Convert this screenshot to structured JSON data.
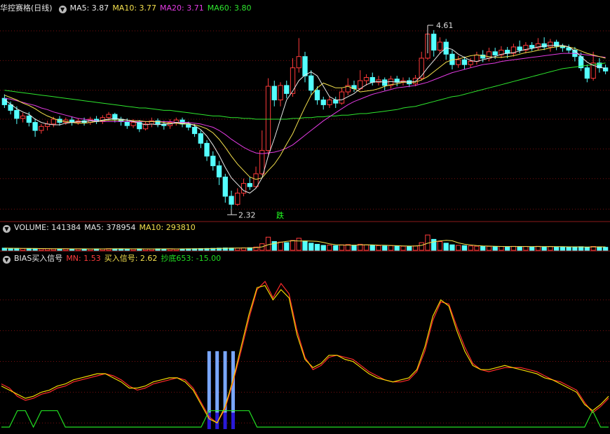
{
  "colors": {
    "up": "#ff3a3a",
    "down": "#54ffff",
    "ma5": "#e8e8e8",
    "ma10": "#f4e04d",
    "ma20": "#e33be3",
    "ma60": "#2ee62e",
    "grid": "#7a1010",
    "frame": "#8b1a1a",
    "bias_red": "#ff2a2a",
    "bias_yellow": "#f4d800",
    "signal_green": "#22dd22",
    "bar_light": "#7aa7ff",
    "bar_dark": "#2a1ad8"
  },
  "price_panel": {
    "name": "华控赛格(日线)",
    "ma5_label": "MA5: 3.87",
    "ma10_label": "MA10: 3.77",
    "ma20_label": "MA20: 3.71",
    "ma60_label": "MA60: 3.80",
    "high_label": "4.61",
    "low_label": "2.32",
    "marker_text": "跌",
    "collapse_icon": "chevron-down-icon"
  },
  "volume_panel": {
    "name": "VOLUME: 141384",
    "ma5_label": "MA5: 378954",
    "ma10_label": "MA10: 293810"
  },
  "bias_panel": {
    "name": "BIAS买入信号",
    "mn_label": "MN: 1.53",
    "buy_label": "买入信号: 2.62",
    "bottom_label": "抄底653: -15.00"
  },
  "chart_data": {
    "type": "candlestick",
    "price_ylim": [
      2.2,
      4.75
    ],
    "price_gridlines": [
      2.32,
      2.7,
      3.07,
      3.44,
      3.8,
      4.17,
      4.54
    ],
    "candles": [
      [
        3.7,
        3.62,
        3.75,
        3.58
      ],
      [
        3.62,
        3.55,
        3.66,
        3.5
      ],
      [
        3.55,
        3.45,
        3.6,
        3.38
      ],
      [
        3.45,
        3.48,
        3.52,
        3.4
      ],
      [
        3.48,
        3.4,
        3.53,
        3.35
      ],
      [
        3.4,
        3.3,
        3.45,
        3.22
      ],
      [
        3.3,
        3.35,
        3.38,
        3.26
      ],
      [
        3.35,
        3.38,
        3.42,
        3.3
      ],
      [
        3.38,
        3.44,
        3.47,
        3.34
      ],
      [
        3.44,
        3.4,
        3.48,
        3.36
      ],
      [
        3.4,
        3.43,
        3.46,
        3.37
      ],
      [
        3.43,
        3.4,
        3.47,
        3.36
      ],
      [
        3.4,
        3.42,
        3.45,
        3.37
      ],
      [
        3.42,
        3.4,
        3.46,
        3.36
      ],
      [
        3.4,
        3.44,
        3.47,
        3.37
      ],
      [
        3.44,
        3.41,
        3.48,
        3.38
      ],
      [
        3.41,
        3.46,
        3.49,
        3.38
      ],
      [
        3.46,
        3.5,
        3.53,
        3.42
      ],
      [
        3.5,
        3.44,
        3.52,
        3.4
      ],
      [
        3.44,
        3.41,
        3.47,
        3.36
      ],
      [
        3.41,
        3.36,
        3.45,
        3.32
      ],
      [
        3.36,
        3.4,
        3.44,
        3.33
      ],
      [
        3.4,
        3.32,
        3.43,
        3.28
      ],
      [
        3.32,
        3.38,
        3.41,
        3.3
      ],
      [
        3.38,
        3.42,
        3.46,
        3.34
      ],
      [
        3.42,
        3.38,
        3.45,
        3.34
      ],
      [
        3.38,
        3.36,
        3.42,
        3.31
      ],
      [
        3.36,
        3.4,
        3.44,
        3.32
      ],
      [
        3.4,
        3.43,
        3.46,
        3.36
      ],
      [
        3.43,
        3.38,
        3.46,
        3.34
      ],
      [
        3.38,
        3.34,
        3.41,
        3.3
      ],
      [
        3.34,
        3.26,
        3.38,
        3.22
      ],
      [
        3.26,
        3.14,
        3.3,
        3.08
      ],
      [
        3.14,
        2.98,
        3.18,
        2.92
      ],
      [
        2.98,
        2.86,
        3.04,
        2.8
      ],
      [
        2.86,
        2.72,
        2.92,
        2.62
      ],
      [
        2.72,
        2.48,
        2.76,
        2.4
      ],
      [
        2.48,
        2.38,
        2.55,
        2.32
      ],
      [
        2.38,
        2.52,
        2.58,
        2.36
      ],
      [
        2.52,
        2.64,
        2.7,
        2.48
      ],
      [
        2.64,
        2.6,
        2.72,
        2.56
      ],
      [
        2.6,
        2.76,
        2.85,
        2.58
      ],
      [
        2.76,
        3.05,
        3.3,
        2.74
      ],
      [
        3.05,
        3.85,
        3.95,
        3.0
      ],
      [
        3.85,
        3.68,
        3.92,
        3.6
      ],
      [
        3.68,
        3.86,
        3.9,
        3.6
      ],
      [
        3.86,
        3.76,
        3.92,
        3.7
      ],
      [
        3.76,
        4.08,
        4.2,
        3.72
      ],
      [
        4.08,
        4.22,
        4.45,
        4.02
      ],
      [
        4.22,
        3.98,
        4.28,
        3.9
      ],
      [
        3.98,
        3.8,
        4.05,
        3.74
      ],
      [
        3.8,
        3.68,
        3.85,
        3.62
      ],
      [
        3.68,
        3.62,
        3.72,
        3.56
      ],
      [
        3.62,
        3.68,
        3.72,
        3.58
      ],
      [
        3.68,
        3.64,
        3.72,
        3.58
      ],
      [
        3.64,
        3.78,
        3.83,
        3.62
      ],
      [
        3.78,
        3.86,
        3.95,
        3.74
      ],
      [
        3.86,
        3.82,
        3.92,
        3.78
      ],
      [
        3.82,
        3.92,
        4.05,
        3.8
      ],
      [
        3.92,
        3.96,
        4.0,
        3.86
      ],
      [
        3.96,
        3.9,
        4.02,
        3.86
      ],
      [
        3.9,
        3.93,
        3.98,
        3.86
      ],
      [
        3.93,
        3.86,
        3.96,
        3.8
      ],
      [
        3.86,
        3.94,
        3.98,
        3.82
      ],
      [
        3.94,
        3.9,
        3.98,
        3.85
      ],
      [
        3.9,
        3.92,
        3.96,
        3.86
      ],
      [
        3.92,
        3.88,
        3.96,
        3.84
      ],
      [
        3.88,
        3.95,
        3.99,
        3.85
      ],
      [
        3.95,
        4.2,
        4.28,
        3.92
      ],
      [
        4.2,
        4.5,
        4.61,
        4.18
      ],
      [
        4.5,
        4.3,
        4.55,
        4.22
      ],
      [
        4.3,
        4.4,
        4.46,
        4.26
      ],
      [
        4.4,
        4.25,
        4.44,
        4.18
      ],
      [
        4.25,
        4.12,
        4.3,
        4.06
      ],
      [
        4.12,
        4.18,
        4.23,
        4.08
      ],
      [
        4.18,
        4.12,
        4.22,
        4.06
      ],
      [
        4.12,
        4.16,
        4.2,
        4.08
      ],
      [
        4.16,
        4.24,
        4.28,
        4.12
      ],
      [
        4.24,
        4.2,
        4.3,
        4.15
      ],
      [
        4.2,
        4.28,
        4.33,
        4.16
      ],
      [
        4.28,
        4.24,
        4.33,
        4.19
      ],
      [
        4.24,
        4.3,
        4.35,
        4.2
      ],
      [
        4.3,
        4.26,
        4.34,
        4.2
      ],
      [
        4.26,
        4.34,
        4.38,
        4.22
      ],
      [
        4.34,
        4.3,
        4.42,
        4.26
      ],
      [
        4.3,
        4.36,
        4.4,
        4.26
      ],
      [
        4.36,
        4.33,
        4.4,
        4.29
      ],
      [
        4.33,
        4.38,
        4.45,
        4.3
      ],
      [
        4.38,
        4.34,
        4.46,
        4.3
      ],
      [
        4.34,
        4.4,
        4.44,
        4.28
      ],
      [
        4.4,
        4.35,
        4.43,
        4.3
      ],
      [
        4.35,
        4.33,
        4.38,
        4.28
      ],
      [
        4.33,
        4.3,
        4.37,
        4.26
      ],
      [
        4.3,
        4.22,
        4.34,
        4.16
      ],
      [
        4.22,
        4.08,
        4.27,
        4.04
      ],
      [
        4.08,
        3.95,
        4.12,
        3.9
      ],
      [
        3.95,
        4.14,
        4.28,
        3.92
      ],
      [
        4.14,
        4.08,
        4.2,
        4.02
      ],
      [
        4.08,
        4.04,
        4.12,
        4.0
      ]
    ],
    "ma5": [
      3.68,
      3.63,
      3.57,
      3.53,
      3.5,
      3.44,
      3.4,
      3.38,
      3.37,
      3.37,
      3.39,
      3.4,
      3.41,
      3.41,
      3.42,
      3.41,
      3.43,
      3.44,
      3.45,
      3.44,
      3.43,
      3.41,
      3.39,
      3.37,
      3.38,
      3.37,
      3.38,
      3.38,
      3.4,
      3.39,
      3.39,
      3.36,
      3.31,
      3.23,
      3.12,
      2.99,
      2.84,
      2.71,
      2.63,
      2.55,
      2.52,
      2.58,
      2.71,
      2.98,
      3.2,
      3.44,
      3.68,
      3.79,
      3.92,
      3.99,
      4.03,
      3.98,
      3.85,
      3.72,
      3.68,
      3.68,
      3.72,
      3.76,
      3.82,
      3.87,
      3.9,
      3.91,
      3.9,
      3.91,
      3.9,
      3.91,
      3.9,
      3.91,
      3.98,
      4.08,
      4.17,
      4.26,
      4.33,
      4.31,
      4.25,
      4.21,
      4.17,
      4.16,
      4.18,
      4.2,
      4.22,
      4.25,
      4.26,
      4.27,
      4.29,
      4.31,
      4.32,
      4.34,
      4.35,
      4.36,
      4.36,
      4.36,
      4.34,
      4.29,
      4.22,
      4.15,
      4.11,
      4.09,
      4.07
    ],
    "ma10": [
      3.74,
      3.71,
      3.68,
      3.64,
      3.61,
      3.57,
      3.52,
      3.48,
      3.45,
      3.42,
      3.41,
      3.4,
      3.39,
      3.39,
      3.4,
      3.41,
      3.42,
      3.43,
      3.43,
      3.43,
      3.43,
      3.42,
      3.42,
      3.41,
      3.41,
      3.41,
      3.4,
      3.39,
      3.39,
      3.38,
      3.38,
      3.37,
      3.35,
      3.32,
      3.27,
      3.19,
      3.09,
      2.98,
      2.88,
      2.8,
      2.72,
      2.69,
      2.71,
      2.8,
      2.88,
      2.99,
      3.13,
      3.26,
      3.43,
      3.59,
      3.74,
      3.83,
      3.89,
      3.86,
      3.83,
      3.83,
      3.85,
      3.82,
      3.78,
      3.79,
      3.8,
      3.82,
      3.85,
      3.87,
      3.88,
      3.9,
      3.9,
      3.9,
      3.93,
      3.97,
      4.03,
      4.09,
      4.15,
      4.18,
      4.19,
      4.21,
      4.23,
      4.24,
      4.23,
      4.22,
      4.21,
      4.21,
      4.22,
      4.23,
      4.25,
      4.27,
      4.28,
      4.3,
      4.31,
      4.33,
      4.34,
      4.35,
      4.34,
      4.32,
      4.29,
      4.26,
      4.24,
      4.22,
      4.2
    ],
    "ma20": [
      3.7,
      3.69,
      3.67,
      3.65,
      3.63,
      3.61,
      3.58,
      3.56,
      3.53,
      3.51,
      3.49,
      3.47,
      3.45,
      3.44,
      3.43,
      3.42,
      3.41,
      3.41,
      3.41,
      3.41,
      3.41,
      3.41,
      3.41,
      3.41,
      3.41,
      3.41,
      3.41,
      3.41,
      3.4,
      3.4,
      3.4,
      3.39,
      3.38,
      3.36,
      3.34,
      3.3,
      3.25,
      3.19,
      3.14,
      3.09,
      3.05,
      3.02,
      3.01,
      3.02,
      3.03,
      3.05,
      3.08,
      3.12,
      3.18,
      3.24,
      3.3,
      3.36,
      3.42,
      3.47,
      3.52,
      3.57,
      3.62,
      3.66,
      3.69,
      3.72,
      3.75,
      3.77,
      3.79,
      3.81,
      3.83,
      3.84,
      3.85,
      3.86,
      3.88,
      3.9,
      3.93,
      3.96,
      3.99,
      4.02,
      4.04,
      4.06,
      4.08,
      4.1,
      4.12,
      4.13,
      4.14,
      4.16,
      4.17,
      4.18,
      4.19,
      4.2,
      4.21,
      4.22,
      4.23,
      4.24,
      4.25,
      4.26,
      4.26,
      4.26,
      4.25,
      4.24,
      4.23,
      4.22,
      4.21
    ],
    "ma60": [
      3.8,
      3.79,
      3.78,
      3.77,
      3.76,
      3.75,
      3.74,
      3.73,
      3.72,
      3.71,
      3.7,
      3.69,
      3.68,
      3.67,
      3.66,
      3.65,
      3.64,
      3.63,
      3.62,
      3.61,
      3.6,
      3.59,
      3.58,
      3.58,
      3.57,
      3.56,
      3.55,
      3.55,
      3.54,
      3.53,
      3.52,
      3.51,
      3.5,
      3.49,
      3.48,
      3.48,
      3.47,
      3.46,
      3.46,
      3.45,
      3.45,
      3.44,
      3.44,
      3.44,
      3.44,
      3.44,
      3.44,
      3.45,
      3.45,
      3.46,
      3.46,
      3.47,
      3.47,
      3.48,
      3.48,
      3.49,
      3.49,
      3.5,
      3.51,
      3.51,
      3.52,
      3.53,
      3.54,
      3.55,
      3.56,
      3.58,
      3.59,
      3.6,
      3.62,
      3.64,
      3.66,
      3.68,
      3.7,
      3.72,
      3.73,
      3.75,
      3.77,
      3.79,
      3.81,
      3.83,
      3.85,
      3.87,
      3.89,
      3.91,
      3.93,
      3.95,
      3.97,
      3.99,
      4.01,
      4.03,
      4.05,
      4.07,
      4.08,
      4.09,
      4.1,
      4.11,
      4.12,
      4.13,
      4.14
    ],
    "volume": [
      0.4,
      0.38,
      0.35,
      0.32,
      0.3,
      0.33,
      0.28,
      0.3,
      0.27,
      0.26,
      0.28,
      0.25,
      0.27,
      0.26,
      0.25,
      0.27,
      0.26,
      0.3,
      0.28,
      0.27,
      0.26,
      0.25,
      0.27,
      0.26,
      0.25,
      0.28,
      0.26,
      0.27,
      0.25,
      0.26,
      0.28,
      0.3,
      0.32,
      0.34,
      0.36,
      0.4,
      0.44,
      0.42,
      0.4,
      0.45,
      0.48,
      0.6,
      1.2,
      2.4,
      1.6,
      1.5,
      1.4,
      1.8,
      2.2,
      1.7,
      1.3,
      1.1,
      0.9,
      0.95,
      0.85,
      1.0,
      1.05,
      0.9,
      1.1,
      1.0,
      0.9,
      0.85,
      0.8,
      0.85,
      0.8,
      0.75,
      0.72,
      0.8,
      1.4,
      2.8,
      2.0,
      1.6,
      1.3,
      1.0,
      0.9,
      0.85,
      0.8,
      0.75,
      0.7,
      0.72,
      0.68,
      0.7,
      0.66,
      0.72,
      0.68,
      0.7,
      0.65,
      0.72,
      0.66,
      0.7,
      0.64,
      0.62,
      0.6,
      0.62,
      0.66,
      0.58,
      0.7,
      0.64,
      0.55
    ],
    "volume_ylim": [
      0,
      3.2
    ],
    "bias_ylim": [
      -18,
      62
    ],
    "bias_gridlines": [
      -15,
      0,
      15,
      30,
      45
    ],
    "bias_mn": [
      4,
      2,
      -2,
      -4,
      -3,
      -1,
      0,
      2,
      3,
      5,
      6,
      7,
      8,
      9,
      8,
      6,
      3,
      1,
      2,
      4,
      5,
      6,
      7,
      6,
      2,
      -5,
      -12,
      -15,
      -8,
      5,
      20,
      36,
      50,
      54,
      46,
      53,
      48,
      30,
      17,
      11,
      13,
      17,
      18,
      17,
      16,
      13,
      10,
      8,
      6,
      5,
      5,
      6,
      10,
      20,
      35,
      44,
      43,
      32,
      22,
      14,
      11,
      10,
      11,
      12,
      12,
      12,
      11,
      10,
      8,
      6,
      5,
      3,
      1,
      -5,
      -10,
      -7,
      -3
    ],
    "bias_buy": [
      3,
      1,
      -1,
      -3,
      -2,
      0,
      1,
      3,
      4,
      6,
      7,
      8,
      9,
      9,
      7,
      5,
      2,
      2,
      3,
      5,
      6,
      7,
      7,
      5,
      1,
      -6,
      -13,
      -15,
      -7,
      6,
      22,
      38,
      51,
      52,
      45,
      50,
      46,
      28,
      16,
      12,
      14,
      18,
      18,
      16,
      15,
      12,
      9,
      7,
      6,
      5,
      6,
      7,
      11,
      22,
      37,
      45,
      42,
      30,
      20,
      13,
      11,
      11,
      12,
      13,
      12,
      11,
      10,
      9,
      7,
      6,
      4,
      2,
      0,
      -6,
      -9,
      -6,
      -2
    ],
    "signal_green": [
      0,
      0,
      1,
      1,
      0,
      1,
      1,
      1,
      0,
      0,
      0,
      0,
      0,
      0,
      0,
      0,
      0,
      0,
      0,
      0,
      0,
      0,
      0,
      0,
      0,
      0,
      1,
      1,
      1,
      1,
      1,
      1,
      0,
      0,
      0,
      0,
      0,
      0,
      0,
      0,
      0,
      0,
      0,
      0,
      0,
      0,
      0,
      0,
      0,
      0,
      0,
      0,
      0,
      0,
      0,
      0,
      0,
      0,
      0,
      0,
      0,
      0,
      0,
      0,
      0,
      0,
      0,
      0,
      0,
      0,
      0,
      0,
      0,
      0,
      1,
      0,
      0
    ],
    "signal_bars_index": [
      26,
      27,
      28,
      29
    ]
  }
}
